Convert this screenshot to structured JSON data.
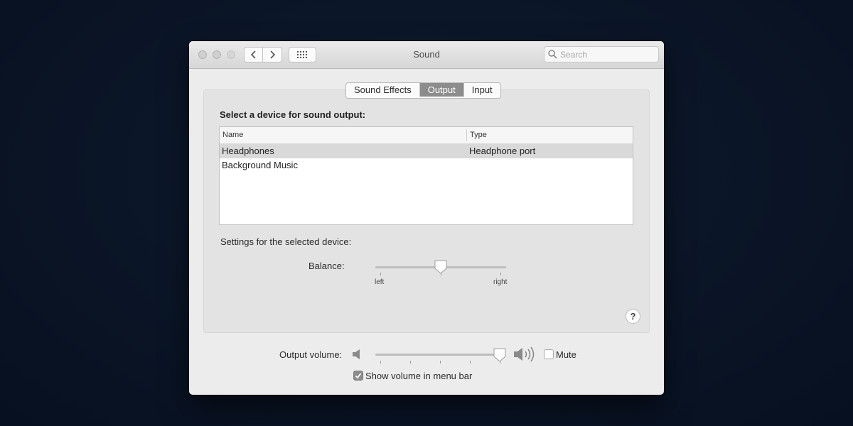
{
  "window": {
    "title": "Sound",
    "search_placeholder": "Search"
  },
  "tabs": [
    {
      "label": "Sound Effects",
      "active": false
    },
    {
      "label": "Output",
      "active": true
    },
    {
      "label": "Input",
      "active": false
    }
  ],
  "output": {
    "section_title": "Select a device for sound output:",
    "columns": [
      "Name",
      "Type"
    ],
    "devices": [
      {
        "name": "Headphones",
        "type": "Headphone port",
        "selected": true
      },
      {
        "name": "Background Music",
        "type": "",
        "selected": false
      }
    ],
    "settings_title": "Settings for the selected device:",
    "balance": {
      "label": "Balance:",
      "left_label": "left",
      "right_label": "right",
      "value": 0.5
    }
  },
  "help_label": "?",
  "volume": {
    "label": "Output volume:",
    "level": 0.97,
    "mute_label": "Mute",
    "mute_checked": false,
    "show_in_menu_bar_label": "Show volume in menu bar",
    "show_in_menu_bar_checked": true
  },
  "colors": {
    "accent_tab": "#8c8c8c",
    "selection_row": "#d9d9d9"
  }
}
